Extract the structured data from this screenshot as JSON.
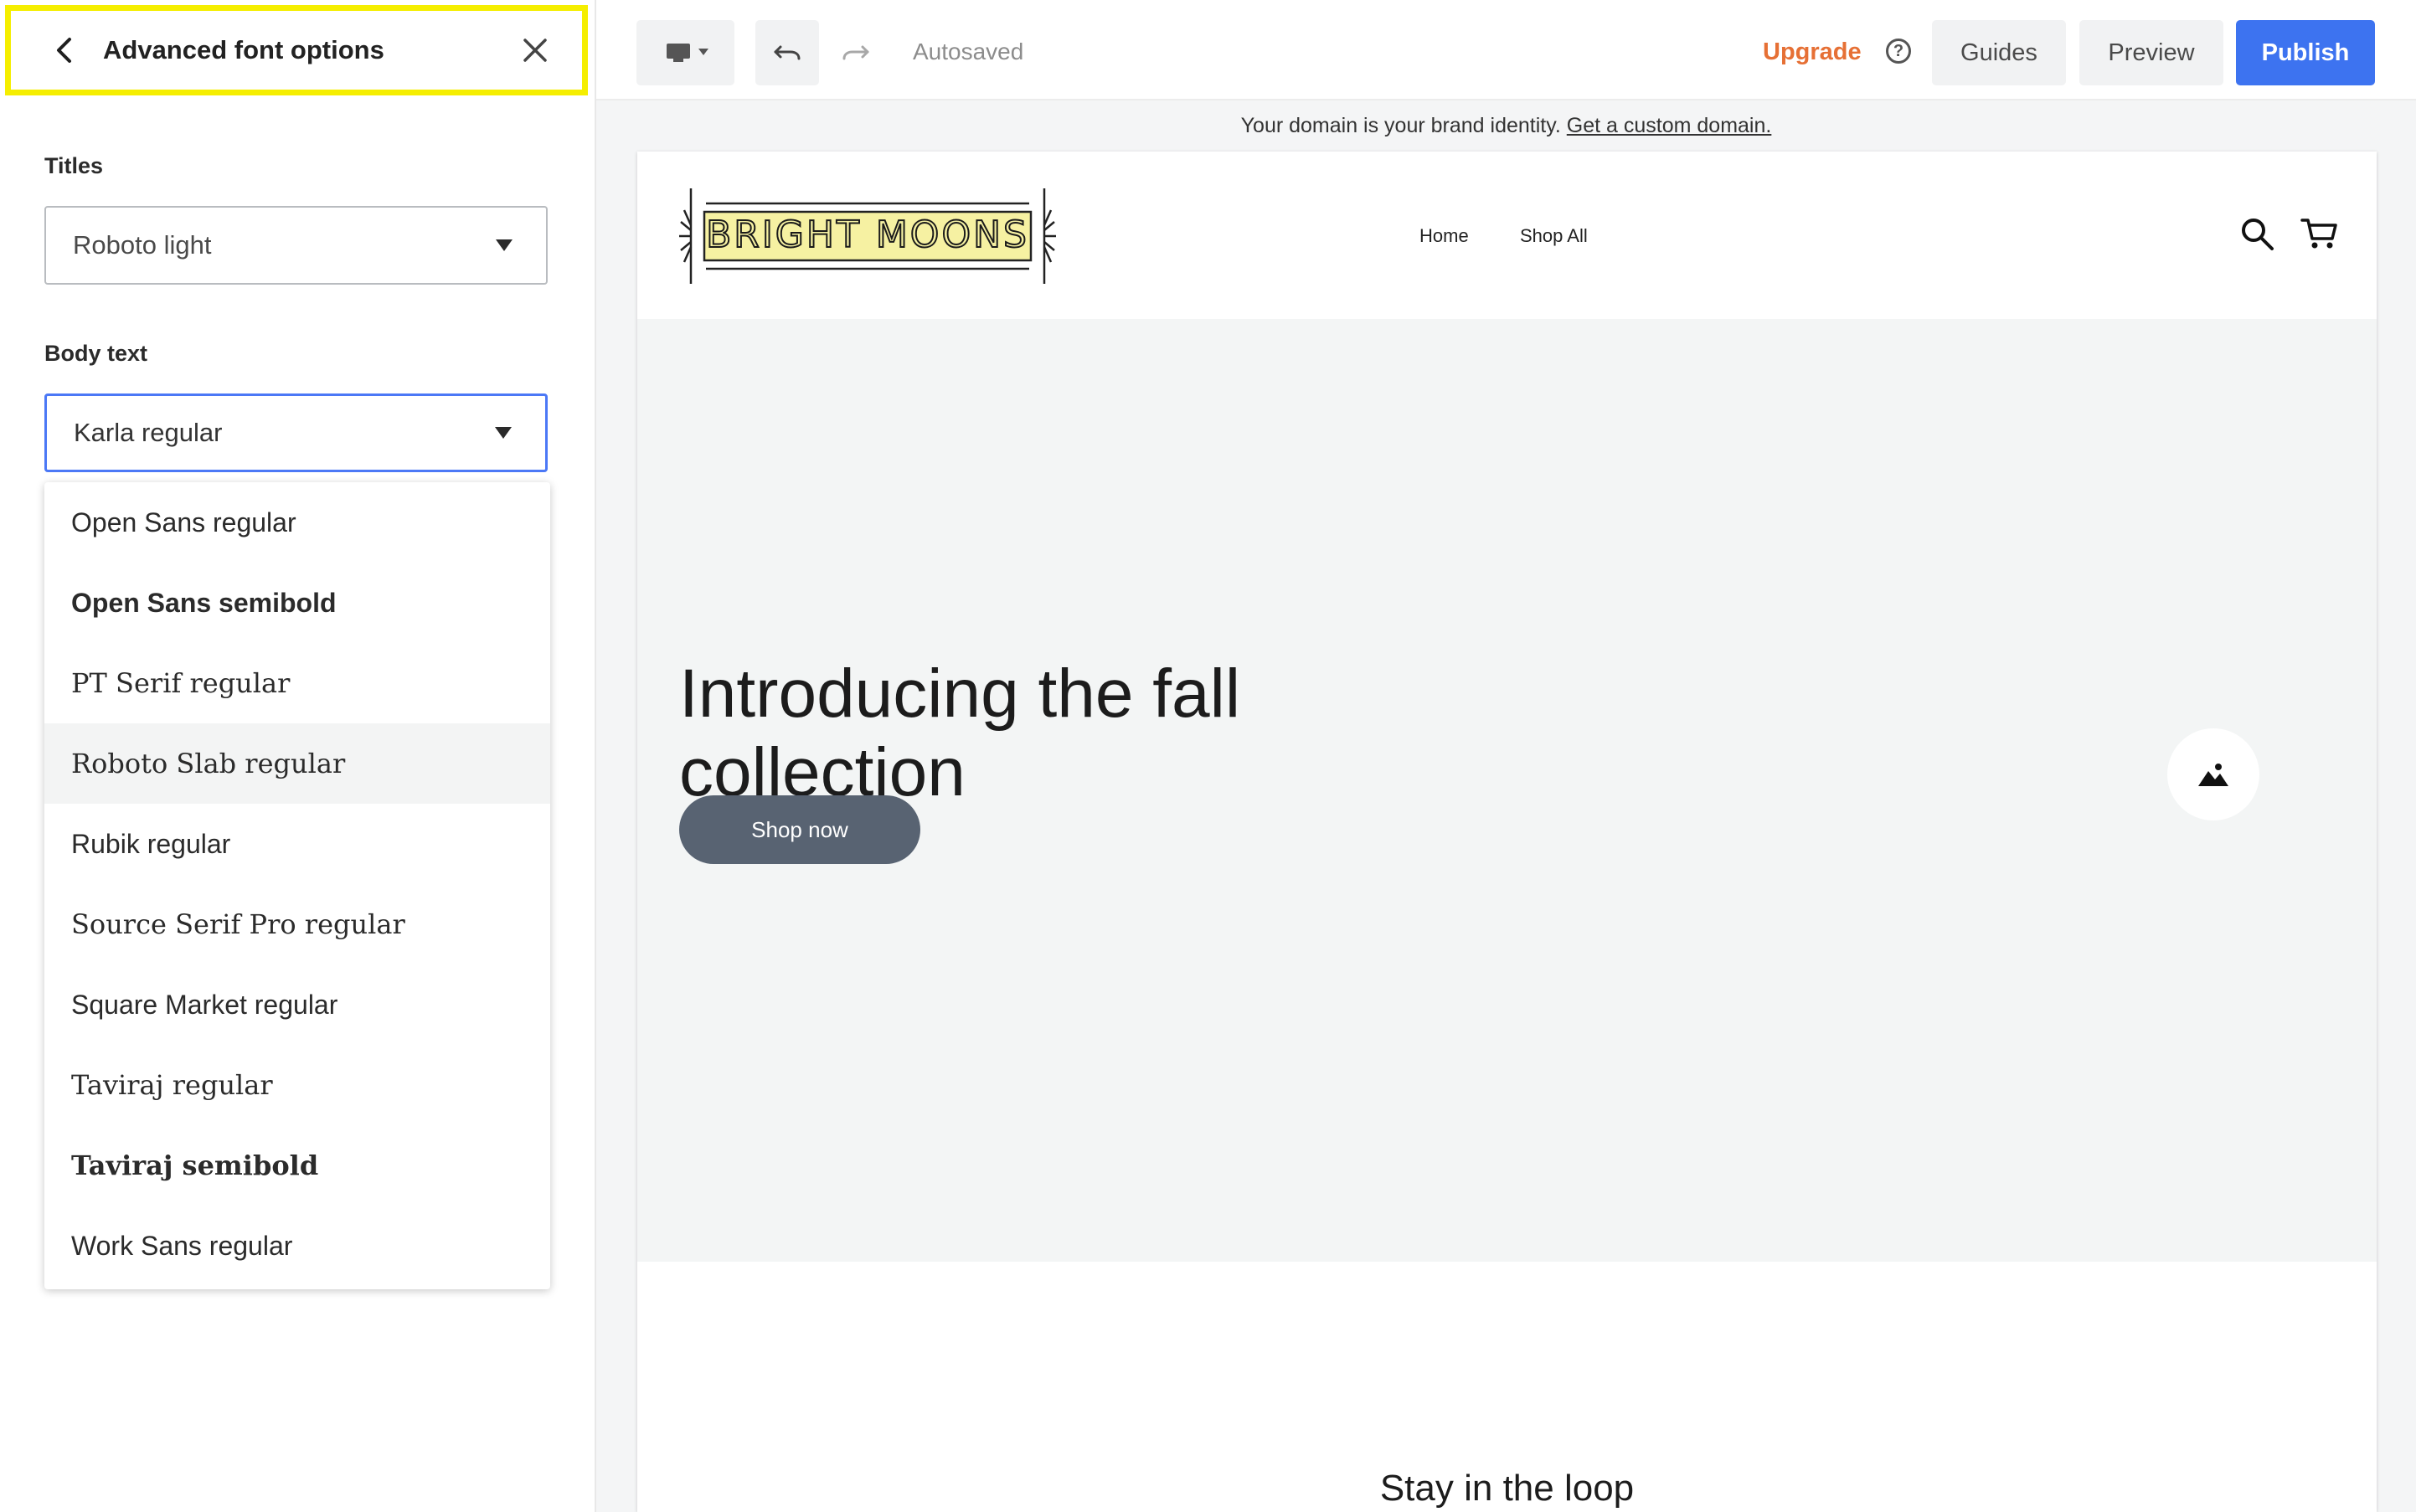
{
  "left_panel": {
    "title": "Advanced font options",
    "titles_label": "Titles",
    "titles_value": "Roboto light",
    "body_label": "Body text",
    "body_value": "Karla regular",
    "font_options": [
      "Open Sans regular",
      "Open Sans semibold",
      "PT Serif regular",
      "Roboto Slab regular",
      "Rubik regular",
      "Source Serif Pro regular",
      "Square Market regular",
      "Taviraj regular",
      "Taviraj semibold",
      "Work Sans regular"
    ],
    "hovered_option": "Roboto Slab regular"
  },
  "topbar": {
    "device_icon": "desktop-icon",
    "status": "Autosaved",
    "upgrade": "Upgrade",
    "help_icon": "?",
    "guides": "Guides",
    "preview": "Preview",
    "publish": "Publish"
  },
  "domain_notice": {
    "text": "Your domain is your brand identity.",
    "link": "Get a custom domain."
  },
  "site": {
    "logo_text": "BRIGHT MOONS",
    "nav": [
      "Home",
      "Shop All"
    ],
    "hero_title": "Introducing the fall collection",
    "hero_button": "Shop now",
    "newsletter_title": "Stay in the loop"
  },
  "colors": {
    "highlight_border": "#f5ee00",
    "accent_blue": "#3d73f0",
    "upgrade_orange": "#e67035",
    "shop_button": "#586372"
  }
}
